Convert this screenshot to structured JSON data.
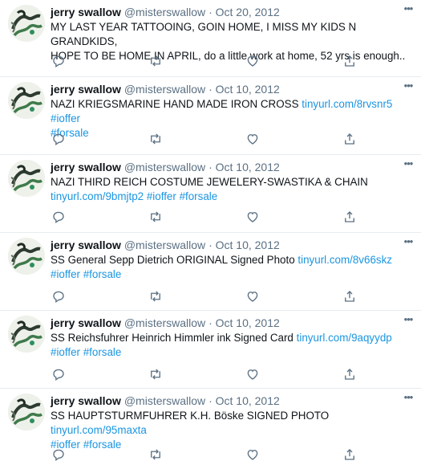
{
  "tweets": [
    {
      "author": "jerry swallow",
      "handle": "@misterswallow",
      "sep": "·",
      "date": "Oct 20, 2012",
      "lines": [
        {
          "text": "MY LAST YEAR TATTOOING, GOIN HOME, I MISS MY KIDS N GRANDKIDS,",
          "links": []
        },
        {
          "text": "HOPE TO BE HOME IN APRIL, do a little work at home, 52 yrs is enough..",
          "links": []
        }
      ]
    },
    {
      "author": "jerry swallow",
      "handle": "@misterswallow",
      "sep": "·",
      "date": "Oct 10, 2012",
      "lines": [
        {
          "text": "NAZI KRIEGSMARINE HAND MADE IRON CROSS",
          "links": [
            "tinyurl.com/8rvsnr5",
            "#ioffer"
          ]
        },
        {
          "text": "",
          "links": [
            "#forsale"
          ]
        }
      ]
    },
    {
      "author": "jerry swallow",
      "handle": "@misterswallow",
      "sep": "·",
      "date": "Oct 10, 2012",
      "lines": [
        {
          "text": "NAZI THIRD REICH COSTUME JEWELERY-SWASTIKA & CHAIN",
          "links": []
        },
        {
          "text": "",
          "links": [
            "tinyurl.com/9bmjtp2",
            "#ioffer",
            "#forsale"
          ]
        }
      ]
    },
    {
      "author": "jerry swallow",
      "handle": "@misterswallow",
      "sep": "·",
      "date": "Oct 10, 2012",
      "lines": [
        {
          "text": "SS General Sepp Dietrich ORIGINAL Signed Photo",
          "links": [
            "tinyurl.com/8v66skz"
          ]
        },
        {
          "text": "",
          "links": [
            "#ioffer",
            "#forsale"
          ]
        }
      ]
    },
    {
      "author": "jerry swallow",
      "handle": "@misterswallow",
      "sep": "·",
      "date": "Oct 10, 2012",
      "lines": [
        {
          "text": "SS Reichsfuhrer Heinrich Himmler ink Signed Card",
          "links": [
            "tinyurl.com/9aqyydp"
          ]
        },
        {
          "text": "",
          "links": [
            "#ioffer",
            "#forsale"
          ]
        }
      ]
    },
    {
      "author": "jerry swallow",
      "handle": "@misterswallow",
      "sep": "·",
      "date": "Oct 10, 2012",
      "lines": [
        {
          "text": "SS HAUPTSTURMFUHRER K.H. Böske SIGNED PHOTO",
          "links": [
            "tinyurl.com/95maxta"
          ]
        },
        {
          "text": "",
          "links": [
            "#ioffer",
            "#forsale"
          ]
        }
      ]
    }
  ],
  "icons": {
    "more": "more-options-icon",
    "reply": "reply-icon",
    "retweet": "retweet-icon",
    "like": "like-icon",
    "share": "share-icon"
  },
  "colors": {
    "link": "#1b95e0",
    "muted": "#5b7083",
    "text": "#0f1419",
    "divider": "#e6ecf0"
  }
}
